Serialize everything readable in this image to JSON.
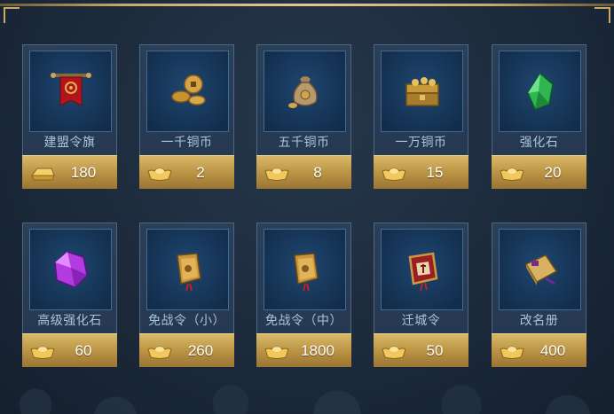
{
  "items": [
    {
      "name": "建盟令旗",
      "price": "180",
      "icon": "guild-banner-icon",
      "currency": "gold-bar-icon"
    },
    {
      "name": "一千铜币",
      "price": "2",
      "icon": "copper-coins-icon",
      "currency": "gold-ingot-icon"
    },
    {
      "name": "五千铜币",
      "price": "8",
      "icon": "coin-bag-icon",
      "currency": "gold-ingot-icon"
    },
    {
      "name": "一万铜币",
      "price": "15",
      "icon": "treasure-chest-icon",
      "currency": "gold-ingot-icon"
    },
    {
      "name": "强化石",
      "price": "20",
      "icon": "green-gem-icon",
      "currency": "gold-ingot-icon"
    },
    {
      "name": "高级强化石",
      "price": "60",
      "icon": "purple-gem-icon",
      "currency": "gold-ingot-icon"
    },
    {
      "name": "免战令（小）",
      "price": "260",
      "icon": "truce-token-small-icon",
      "currency": "gold-ingot-icon"
    },
    {
      "name": "免战令（中）",
      "price": "1800",
      "icon": "truce-token-medium-icon",
      "currency": "gold-ingot-icon"
    },
    {
      "name": "迁城令",
      "price": "50",
      "icon": "relocation-token-icon",
      "currency": "gold-ingot-icon"
    },
    {
      "name": "改名册",
      "price": "400",
      "icon": "rename-book-icon",
      "currency": "gold-ingot-icon"
    }
  ]
}
